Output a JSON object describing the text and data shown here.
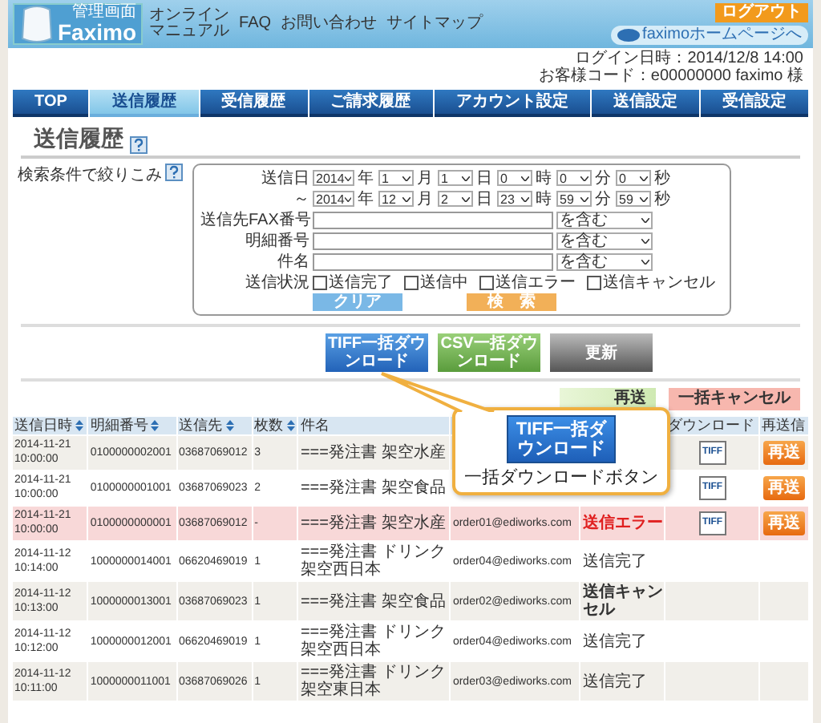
{
  "header": {
    "logo_caption": "管理画面",
    "logo_text": "Faximo",
    "links": [
      {
        "label": "オンラインマニュアル"
      },
      {
        "label": "FAQ"
      },
      {
        "label": "お問い合わせ"
      },
      {
        "label": "サイトマップ"
      }
    ],
    "logout": "ログアウト",
    "home_link": "faximoホームページへ"
  },
  "login": {
    "datetime": "ログイン日時：2014/12/8 14:00",
    "customer": "お客様コード：e00000000 faximo 様"
  },
  "tabs": [
    {
      "label": "TOP",
      "selected": false
    },
    {
      "label": "送信履歴",
      "selected": true
    },
    {
      "label": "受信履歴",
      "selected": false
    },
    {
      "label": "ご請求履歴",
      "selected": false
    },
    {
      "label": "アカウント設定",
      "selected": false
    },
    {
      "label": "送信設定",
      "selected": false
    },
    {
      "label": "受信設定",
      "selected": false
    }
  ],
  "page_title": "送信履歴",
  "search": {
    "title": "検索条件で絞りこみ",
    "date_rows": [
      {
        "label": "送信日",
        "fields": [
          {
            "value": "2014",
            "unit": "年"
          },
          {
            "value": "1",
            "unit": "月"
          },
          {
            "value": "1",
            "unit": "日"
          },
          {
            "value": "0",
            "unit": "時"
          },
          {
            "value": "0",
            "unit": "分"
          },
          {
            "value": "0",
            "unit": "秒"
          }
        ]
      },
      {
        "label": "～",
        "fields": [
          {
            "value": "2014",
            "unit": "年"
          },
          {
            "value": "12",
            "unit": "月"
          },
          {
            "value": "2",
            "unit": "日"
          },
          {
            "value": "23",
            "unit": "時"
          },
          {
            "value": "59",
            "unit": "分"
          },
          {
            "value": "59",
            "unit": "秒"
          }
        ]
      }
    ],
    "text_rows": [
      {
        "label": "送信先FAX番号",
        "match": "を含む"
      },
      {
        "label": "明細番号",
        "match": "を含む"
      },
      {
        "label": "件名",
        "match": "を含む"
      }
    ],
    "status_label": "送信状況",
    "statuses": [
      {
        "label": "送信完了",
        "checked": false
      },
      {
        "label": "送信中",
        "checked": false
      },
      {
        "label": "送信エラー",
        "checked": false
      },
      {
        "label": "送信キャンセル",
        "checked": false
      }
    ],
    "clear": "クリア",
    "submit": "検　索"
  },
  "downloads": [
    {
      "label": "TIFF一括ダウンロード",
      "kind": "tiff"
    },
    {
      "label": "CSV一括ダウンロード",
      "kind": "csv"
    },
    {
      "label": "更新",
      "kind": "refresh"
    }
  ],
  "actions": [
    {
      "label": "再送",
      "kind": "resend"
    },
    {
      "label": "一括キャンセル",
      "kind": "cancel"
    }
  ],
  "table": {
    "columns": [
      {
        "label": "送信日時",
        "sortable": true
      },
      {
        "label": "明細番号",
        "sortable": true
      },
      {
        "label": "送信先",
        "sortable": true
      },
      {
        "label": "枚数",
        "sortable": true
      },
      {
        "label": "件名",
        "sortable": false
      },
      {},
      {},
      {
        "label": "ダウンロード",
        "sortable": false
      },
      {
        "label": "再送信",
        "sortable": false
      }
    ],
    "rows": [
      {
        "date": "2014-11-21",
        "time": "10:00:00",
        "number": "0100000002001",
        "fax": "03687069012",
        "pages": "3",
        "subject": "===発注書 架空水産",
        "highlighted": false,
        "tiff": "TIFF",
        "resend": "再送"
      },
      {
        "date": "2014-11-21",
        "time": "10:00:00",
        "number": "0100000001001",
        "fax": "03687069023",
        "pages": "2",
        "subject": "===発注書 架空食品",
        "highlighted": false,
        "tiff": "TIFF",
        "resend": "再送"
      },
      {
        "date": "2014-11-21",
        "time": "10:00:00",
        "number": "0100000000001",
        "fax": "03687069012",
        "pages": "-",
        "subject": "===発注書 架空水産",
        "email": "order01@ediworks.com",
        "status": {
          "text": "送信エラー",
          "kind": "error"
        },
        "highlighted": true,
        "tiff": "TIFF",
        "resend": "再送"
      },
      {
        "date": "2014-11-12",
        "time": "10:14:00",
        "number": "1000000014001",
        "fax": "06620469019",
        "pages": "1",
        "subject": "===発注書 ドリンク架空西日本",
        "email": "order04@ediworks.com",
        "status": {
          "text": "送信完了",
          "kind": "done"
        },
        "highlighted": false
      },
      {
        "date": "2014-11-12",
        "time": "10:13:00",
        "number": "1000000013001",
        "fax": "03687069023",
        "pages": "1",
        "subject": "===発注書 架空食品",
        "email": "order02@ediworks.com",
        "status": {
          "text": "送信キャンセル",
          "kind": "cancel"
        },
        "highlighted": false
      },
      {
        "date": "2014-11-12",
        "time": "10:12:00",
        "number": "1000000012001",
        "fax": "06620469019",
        "pages": "1",
        "subject": "===発注書 ドリンク架空西日本",
        "email": "order04@ediworks.com",
        "status": {
          "text": "送信完了",
          "kind": "done"
        },
        "highlighted": false
      },
      {
        "date": "2014-11-12",
        "time": "10:11:00",
        "number": "1000000011001",
        "fax": "03687069026",
        "pages": "1",
        "subject": "===発注書 ドリンク架空東日本",
        "email": "order03@ediworks.com",
        "status": {
          "text": "送信完了",
          "kind": "done"
        },
        "highlighted": false
      }
    ]
  },
  "callout": {
    "button": "TIFF一括ダウンロード",
    "caption": "一括ダウンロードボタン"
  }
}
